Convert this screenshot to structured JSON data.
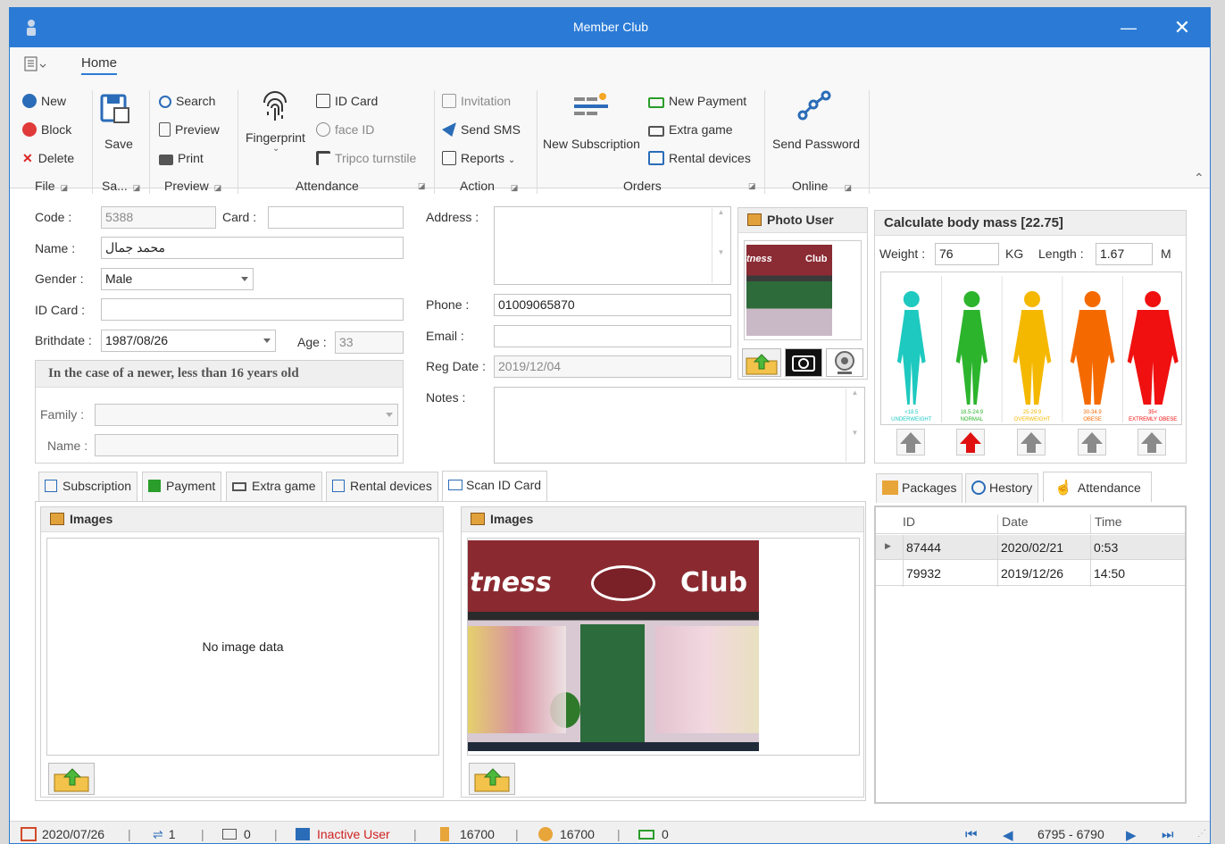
{
  "window": {
    "title": "Member Club",
    "minimize": "—",
    "close": "✕"
  },
  "menu": {
    "home_tab": "Home"
  },
  "ribbon": {
    "file": {
      "new": "New",
      "block": "Block",
      "delete": "Delete",
      "group": "File"
    },
    "save": {
      "save": "Save",
      "group": "Sa..."
    },
    "preview": {
      "search": "Search",
      "preview": "Preview",
      "print": "Print",
      "group": "Preview"
    },
    "attendance": {
      "fingerprint": "Fingerprint",
      "id_card": "ID Card",
      "face_id": "face ID",
      "tripco": "Tripco turnstile",
      "group": "Attendance"
    },
    "action": {
      "invitation": "Invitation",
      "send_sms": "Send SMS",
      "reports": "Reports",
      "group": "Action"
    },
    "orders": {
      "new_subscription": "New Subscription",
      "new_payment": "New Payment",
      "extra_game": "Extra game",
      "rental_devices": "Rental devices",
      "group": "Orders"
    },
    "online": {
      "send_password": "Send Password",
      "group": "Online"
    }
  },
  "form": {
    "code_label": "Code :",
    "code": "5388",
    "card_label": "Card :",
    "card": "",
    "name_label": "Name :",
    "name": "محمد جمال",
    "gender_label": "Gender :",
    "gender": "Male",
    "idcard_label": "ID Card :",
    "idcard": "",
    "birthdate_label": "Brithdate :",
    "birthdate": "1987/08/26",
    "age_label": "Age :",
    "age": "33",
    "minor_title": "In the case of a newer, less than 16 years old",
    "family_label": "Family :",
    "family": "",
    "minor_name_label": "Name :",
    "minor_name": "",
    "address_label": "Address :",
    "address": "",
    "phone_label": "Phone :",
    "phone": "01009065870",
    "email_label": "Email :",
    "email": "",
    "regdate_label": "Reg Date :",
    "regdate": "2019/12/04",
    "notes_label": "Notes :",
    "notes": ""
  },
  "photo": {
    "title": "Photo User",
    "thumb_text_left": "tness",
    "thumb_text_right": "Club"
  },
  "bmi": {
    "title": "Calculate body mass [22.75]",
    "weight_label": "Weight :",
    "weight": "76",
    "weight_unit": "KG",
    "length_label": "Length :",
    "length": "1.67",
    "length_unit": "M",
    "categories": [
      {
        "range": "<18.5",
        "name": "UNDERWEIGHT",
        "color": "#1ec9c0"
      },
      {
        "range": "18.5-24.9",
        "name": "NORMAL",
        "color": "#2db42d"
      },
      {
        "range": "25-29.9",
        "name": "OVERWEIGHT",
        "color": "#f5b800"
      },
      {
        "range": "30-34.9",
        "name": "OBESE",
        "color": "#f56a00"
      },
      {
        "range": "35<",
        "name": "EXTREMLY OBESE",
        "color": "#f01010"
      }
    ],
    "active_index": 1
  },
  "tabs": {
    "subscription": "Subscription",
    "payment": "Payment",
    "extra_game": "Extra game",
    "rental_devices": "Rental devices",
    "scan_id": "Scan ID Card"
  },
  "images": {
    "left_title": "Images",
    "no_image": "No image data",
    "right_title": "Images",
    "sign_left": "tness",
    "sign_right": "Club"
  },
  "right_tabs": {
    "packages": "Packages",
    "history": "Hestory",
    "attendance": "Attendance"
  },
  "attendance_table": {
    "columns": [
      "ID",
      "Date",
      "Time"
    ],
    "rows": [
      {
        "id": "87444",
        "date": "2020/02/21",
        "time": "0:53"
      },
      {
        "id": "79932",
        "date": "2019/12/26",
        "time": "14:50"
      }
    ]
  },
  "status": {
    "date": "2020/07/26",
    "count1": "1",
    "count2": "0",
    "user_state": "Inactive User",
    "amount1": "16700",
    "amount2": "16700",
    "count3": "0",
    "range": "6795 - 6790"
  }
}
